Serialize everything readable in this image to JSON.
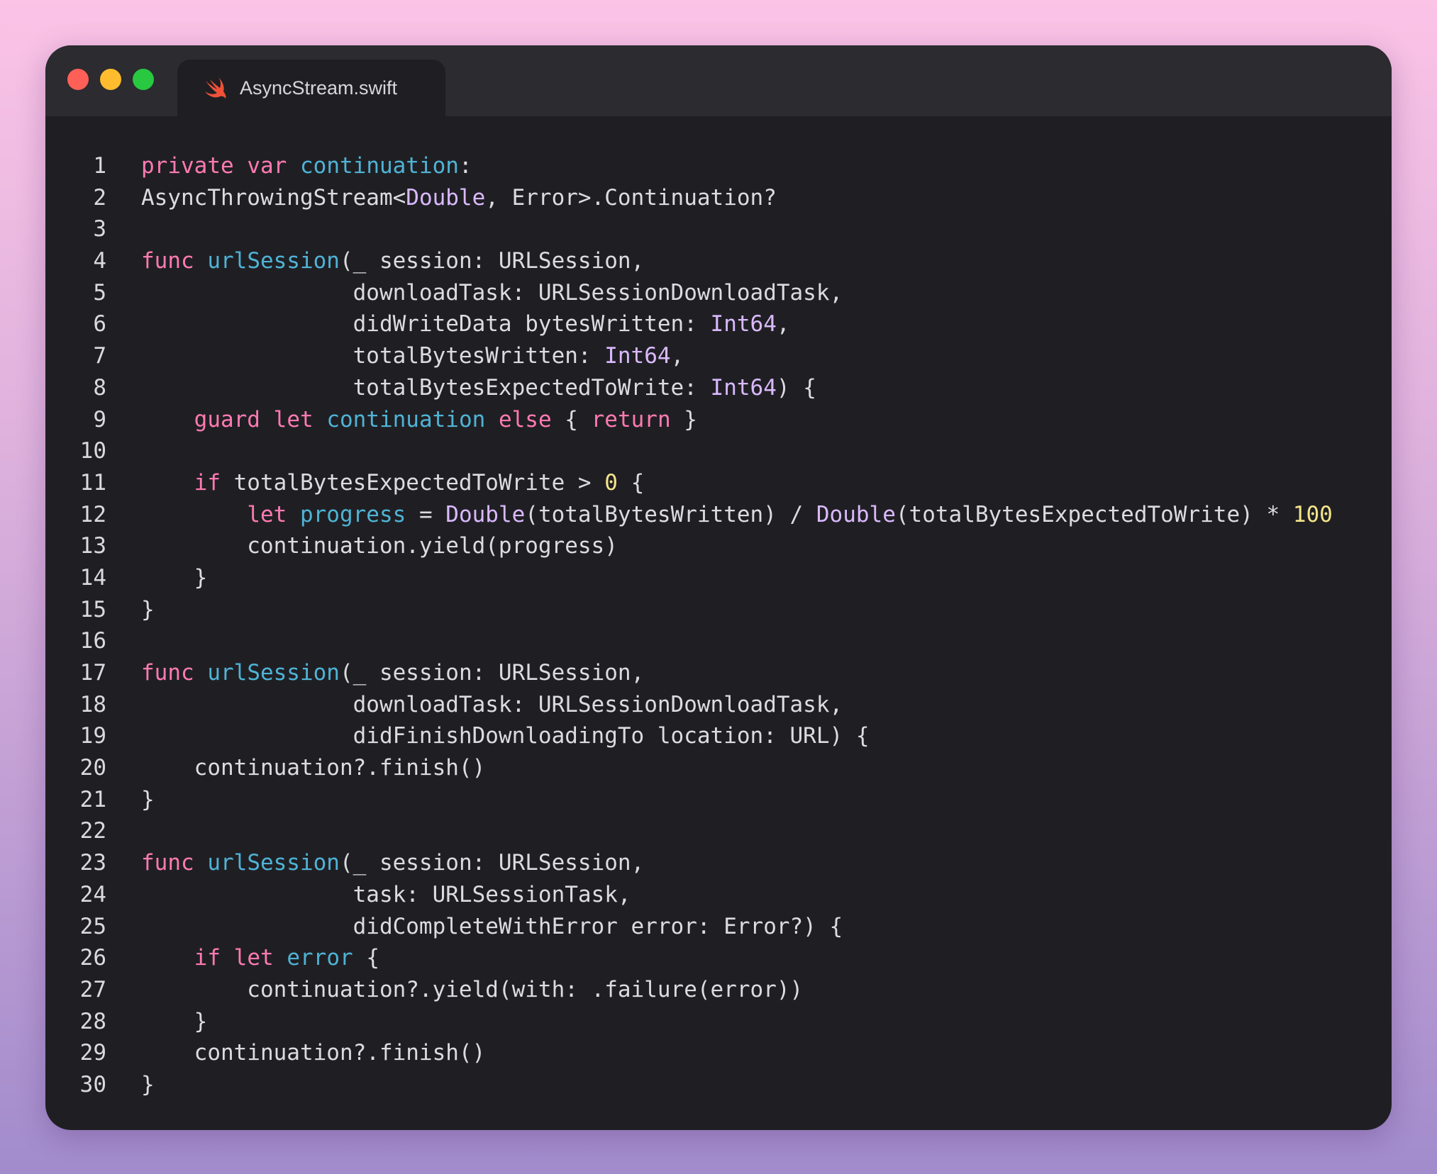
{
  "window": {
    "tab_title": "AsyncStream.swift",
    "tab_icon": "swift-icon",
    "traffic_lights": [
      "close",
      "minimize",
      "zoom"
    ]
  },
  "colors": {
    "background_top": "#fbc3e6",
    "background_bottom": "#a28ccc",
    "editor_bg": "#1f1f23",
    "titlebar_bg": "#2b2b30",
    "keyword": "#ff7ab2",
    "identifier": "#4fb3d6",
    "type": "#dab9ff",
    "number": "#f4e48a",
    "plain": "#dcdce0"
  },
  "code": {
    "lines": [
      {
        "n": "1",
        "tokens": [
          [
            "kw",
            "private"
          ],
          [
            "pl",
            " "
          ],
          [
            "kw",
            "var"
          ],
          [
            "pl",
            " "
          ],
          [
            "id",
            "continuation"
          ],
          [
            "pl",
            ":"
          ]
        ]
      },
      {
        "n": "2",
        "tokens": [
          [
            "pl",
            "AsyncThrowingStream<"
          ],
          [
            "ty",
            "Double"
          ],
          [
            "pl",
            ", Error>.Continuation?"
          ]
        ]
      },
      {
        "n": "3",
        "tokens": []
      },
      {
        "n": "4",
        "tokens": [
          [
            "kw",
            "func"
          ],
          [
            "pl",
            " "
          ],
          [
            "id",
            "urlSession"
          ],
          [
            "pl",
            "(_ session: URLSession,"
          ]
        ]
      },
      {
        "n": "5",
        "tokens": [
          [
            "pl",
            "                downloadTask: URLSessionDownloadTask,"
          ]
        ]
      },
      {
        "n": "6",
        "tokens": [
          [
            "pl",
            "                didWriteData bytesWritten: "
          ],
          [
            "ty",
            "Int64"
          ],
          [
            "pl",
            ","
          ]
        ]
      },
      {
        "n": "7",
        "tokens": [
          [
            "pl",
            "                totalBytesWritten: "
          ],
          [
            "ty",
            "Int64"
          ],
          [
            "pl",
            ","
          ]
        ]
      },
      {
        "n": "8",
        "tokens": [
          [
            "pl",
            "                totalBytesExpectedToWrite: "
          ],
          [
            "ty",
            "Int64"
          ],
          [
            "pl",
            ") {"
          ]
        ]
      },
      {
        "n": "9",
        "tokens": [
          [
            "pl",
            "    "
          ],
          [
            "kw",
            "guard"
          ],
          [
            "pl",
            " "
          ],
          [
            "kw",
            "let"
          ],
          [
            "pl",
            " "
          ],
          [
            "id",
            "continuation"
          ],
          [
            "pl",
            " "
          ],
          [
            "kw",
            "else"
          ],
          [
            "pl",
            " { "
          ],
          [
            "kw",
            "return"
          ],
          [
            "pl",
            " }"
          ]
        ]
      },
      {
        "n": "10",
        "tokens": []
      },
      {
        "n": "11",
        "tokens": [
          [
            "pl",
            "    "
          ],
          [
            "kw",
            "if"
          ],
          [
            "pl",
            " totalBytesExpectedToWrite > "
          ],
          [
            "num",
            "0"
          ],
          [
            "pl",
            " {"
          ]
        ]
      },
      {
        "n": "12",
        "tokens": [
          [
            "pl",
            "        "
          ],
          [
            "kw",
            "let"
          ],
          [
            "pl",
            " "
          ],
          [
            "id",
            "progress"
          ],
          [
            "pl",
            " = "
          ],
          [
            "ty",
            "Double"
          ],
          [
            "pl",
            "(totalBytesWritten) / "
          ],
          [
            "ty",
            "Double"
          ],
          [
            "pl",
            "(totalBytesExpectedToWrite) * "
          ],
          [
            "num",
            "100"
          ]
        ]
      },
      {
        "n": "13",
        "tokens": [
          [
            "pl",
            "        continuation.yield(progress)"
          ]
        ]
      },
      {
        "n": "14",
        "tokens": [
          [
            "pl",
            "    }"
          ]
        ]
      },
      {
        "n": "15",
        "tokens": [
          [
            "pl",
            "}"
          ]
        ]
      },
      {
        "n": "16",
        "tokens": []
      },
      {
        "n": "17",
        "tokens": [
          [
            "kw",
            "func"
          ],
          [
            "pl",
            " "
          ],
          [
            "id",
            "urlSession"
          ],
          [
            "pl",
            "(_ session: URLSession,"
          ]
        ]
      },
      {
        "n": "18",
        "tokens": [
          [
            "pl",
            "                downloadTask: URLSessionDownloadTask,"
          ]
        ]
      },
      {
        "n": "19",
        "tokens": [
          [
            "pl",
            "                didFinishDownloadingTo location: URL) {"
          ]
        ]
      },
      {
        "n": "20",
        "tokens": [
          [
            "pl",
            "    continuation?.finish()"
          ]
        ]
      },
      {
        "n": "21",
        "tokens": [
          [
            "pl",
            "}"
          ]
        ]
      },
      {
        "n": "22",
        "tokens": []
      },
      {
        "n": "23",
        "tokens": [
          [
            "kw",
            "func"
          ],
          [
            "pl",
            " "
          ],
          [
            "id",
            "urlSession"
          ],
          [
            "pl",
            "(_ session: URLSession,"
          ]
        ]
      },
      {
        "n": "24",
        "tokens": [
          [
            "pl",
            "                task: URLSessionTask,"
          ]
        ]
      },
      {
        "n": "25",
        "tokens": [
          [
            "pl",
            "                didCompleteWithError error: Error?) {"
          ]
        ]
      },
      {
        "n": "26",
        "tokens": [
          [
            "pl",
            "    "
          ],
          [
            "kw",
            "if"
          ],
          [
            "pl",
            " "
          ],
          [
            "kw",
            "let"
          ],
          [
            "pl",
            " "
          ],
          [
            "id",
            "error"
          ],
          [
            "pl",
            " {"
          ]
        ]
      },
      {
        "n": "27",
        "tokens": [
          [
            "pl",
            "        continuation?.yield(with: .failure(error))"
          ]
        ]
      },
      {
        "n": "28",
        "tokens": [
          [
            "pl",
            "    }"
          ]
        ]
      },
      {
        "n": "29",
        "tokens": [
          [
            "pl",
            "    continuation?.finish()"
          ]
        ]
      },
      {
        "n": "30",
        "tokens": [
          [
            "pl",
            "}"
          ]
        ]
      }
    ]
  }
}
